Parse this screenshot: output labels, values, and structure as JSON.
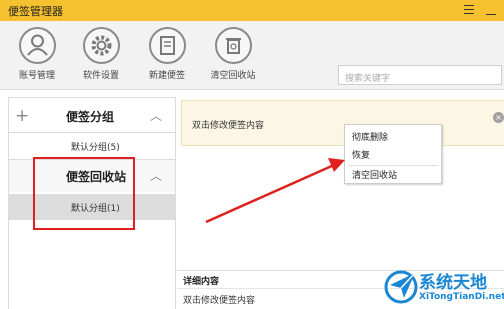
{
  "window": {
    "title": "便签管理器"
  },
  "toolbar": {
    "items": [
      {
        "label": "账号管理",
        "icon": "user-icon"
      },
      {
        "label": "软件设置",
        "icon": "gear-icon"
      },
      {
        "label": "新建便签",
        "icon": "new-note-icon"
      },
      {
        "label": "清空回收站",
        "icon": "trash-icon"
      }
    ],
    "search_placeholder": "搜索关键字"
  },
  "sidebar": {
    "groups_title": "便签分组",
    "groups_default": "默认分组(5)",
    "recycle_title": "便签回收站",
    "recycle_default": "默认分组(1)"
  },
  "note": {
    "text": "双击修改便签内容"
  },
  "context_menu": {
    "items": [
      "彻底删除",
      "恢复",
      "清空回收站"
    ]
  },
  "details": {
    "title": "详细内容",
    "body": "双击修改便签内容"
  },
  "watermark": {
    "name": "系统天地",
    "url": "XiTongTianDi.net"
  },
  "colors": {
    "titlebar": "#f6c12f",
    "annotation": "#e02020",
    "watermark": "#1a86d4"
  }
}
